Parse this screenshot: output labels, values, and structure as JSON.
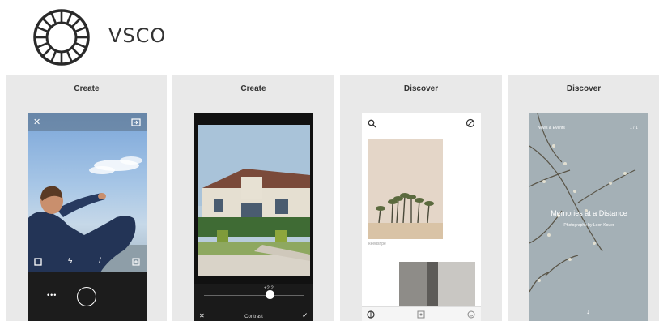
{
  "brand": {
    "name": "VSCO"
  },
  "panels": [
    {
      "title": "Create"
    },
    {
      "title": "Create"
    },
    {
      "title": "Discover"
    },
    {
      "title": "Discover"
    }
  ],
  "camera": {
    "close_icon": "close-icon",
    "flip_icon": "camera-flip-icon",
    "more_label": "•••"
  },
  "editor": {
    "slider_value": "+2.2",
    "tool_label": "Contrast"
  },
  "discover": {
    "caption": "lkeedsnpe"
  },
  "article": {
    "header_left": "News & Events",
    "header_right": "1 / 1",
    "title": "Memories at a Distance",
    "subtitle": "Photographs by Leon Kouer"
  },
  "colors": {
    "panel_bg": "#e9e9e9",
    "camera_dark": "#1c1c1c",
    "sky": "#8fb4de"
  }
}
